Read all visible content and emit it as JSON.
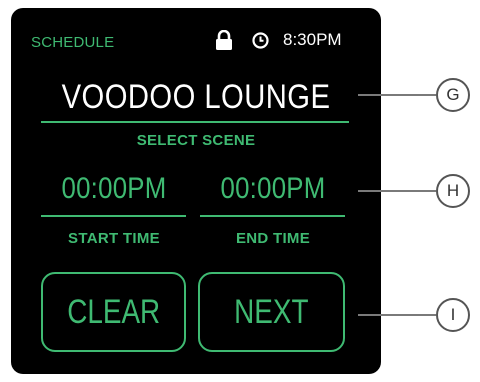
{
  "header": {
    "title": "SCHEDULE",
    "time": "8:30PM"
  },
  "icons": {
    "lock": "lock-icon",
    "clock": "clock-icon"
  },
  "scene": {
    "name": "VOODOO LOUNGE",
    "select_label": "SELECT SCENE"
  },
  "times": {
    "start_value": "00:00PM",
    "start_label": "START TIME",
    "end_value": "00:00PM",
    "end_label": "END TIME"
  },
  "buttons": {
    "clear": "CLEAR",
    "next": "NEXT"
  },
  "callouts": {
    "g": "G",
    "h": "H",
    "i": "I"
  },
  "colors": {
    "accent": "#3fba72",
    "screen_bg": "#000000",
    "text": "#ffffff"
  }
}
